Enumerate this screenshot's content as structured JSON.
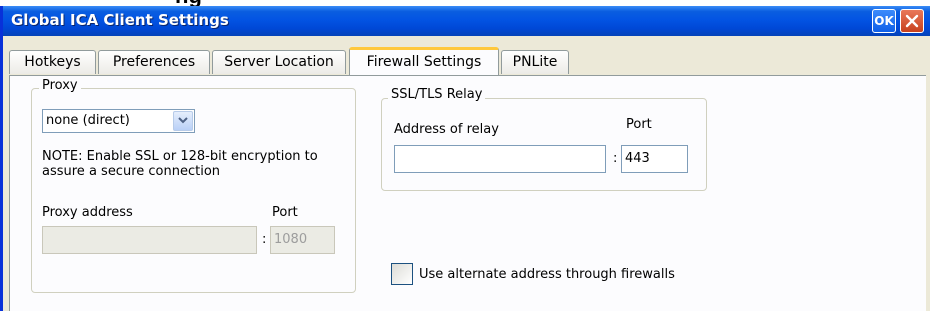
{
  "window": {
    "title": "Global ICA Client Settings"
  },
  "titlebar": {
    "ok_label": "OK"
  },
  "tabs": [
    {
      "label": "Hotkeys"
    },
    {
      "label": "Preferences"
    },
    {
      "label": "Server Location"
    },
    {
      "label": "Firewall Settings",
      "active": true
    },
    {
      "label": "PNLite"
    }
  ],
  "proxy": {
    "legend": "Proxy",
    "type_value": "none (direct)",
    "note": "NOTE: Enable SSL or 128-bit encryption to",
    "note2": "assure a secure connection",
    "address_label": "Proxy address",
    "address_value": "",
    "port_label": "Port",
    "port_value": "1080"
  },
  "ssl_relay": {
    "legend": "SSL/TLS Relay",
    "address_label": "Address of relay",
    "address_value": "",
    "port_label": "Port",
    "port_value": "443"
  },
  "alternate": {
    "label": "Use alternate address through firewalls",
    "checked": false
  },
  "separator": ":"
}
